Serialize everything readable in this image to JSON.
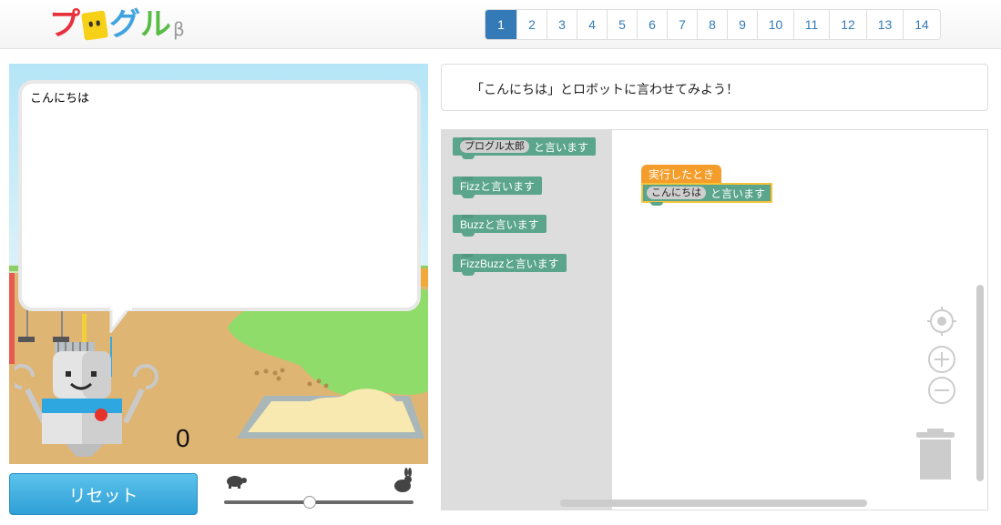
{
  "header": {
    "logo": {
      "c1": "プ",
      "c3": "グ",
      "c4": "ル",
      "beta": "β"
    },
    "pages": [
      "1",
      "2",
      "3",
      "4",
      "5",
      "6",
      "7",
      "8",
      "9",
      "10",
      "11",
      "12",
      "13",
      "14"
    ],
    "active_page": "1"
  },
  "stage": {
    "speech": "こんにちは",
    "counter": "0"
  },
  "controls": {
    "reset_label": "リセット",
    "speed_level": 0.45
  },
  "instruction": "「こんにちは」とロボットに言わせてみよう！",
  "toolbox": {
    "blocks": [
      {
        "pill": "プログル太郎",
        "text": "と言います"
      },
      {
        "text": "Fizzと言います"
      },
      {
        "text": "Buzzと言います"
      },
      {
        "text": "FizzBuzzと言います"
      }
    ]
  },
  "program": {
    "event_label": "実行したとき",
    "say_value": "こんにちは",
    "say_suffix": "と言います"
  },
  "colors": {
    "accent": "#337ab7",
    "block_green": "#5ba58c",
    "event_orange": "#f59d2a",
    "reset_blue": "#3aa8dc"
  }
}
